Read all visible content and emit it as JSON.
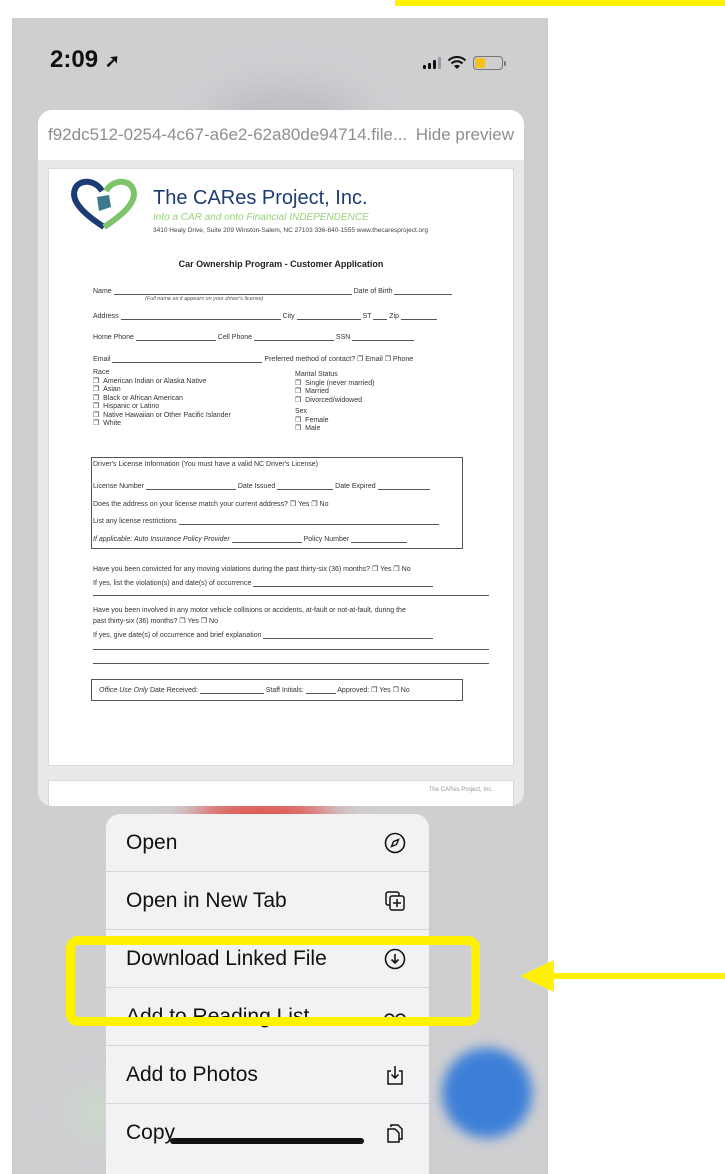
{
  "status_bar": {
    "time": "2:09"
  },
  "preview": {
    "url": "f92dc512-0254-4c67-a6e2-62a80de94714.file...",
    "hide_label": "Hide preview",
    "document": {
      "org_name": "The CARes Project, Inc.",
      "tagline": "Into a CAR and onto Financial INDEPENDENCE",
      "address": "3410 Healy Drive, Suite 209 Winston-Salem, NC 27103   336-840-1555   www.thecaresproject.org",
      "title": "Car Ownership Program - Customer Application",
      "name_label": "Name",
      "name_hint": "(Full name as it appears on your driver's license)",
      "dob_label": "Date of Birth",
      "address_label": "Address",
      "city_label": "City",
      "st_label": "ST",
      "zip_label": "Zip",
      "home_phone_label": "Home Phone",
      "cell_phone_label": "Cell Phone",
      "ssn_label": "SSN",
      "email_label": "Email",
      "contact_pref": "Preferred method of contact? ❒ Email  ❒ Phone",
      "race_label": "Race",
      "race_options": [
        "American Indian or Alaska Native",
        "Asian",
        "Black or African American",
        "Hispanic or Latino",
        "Native Hawaiian or Other Pacific Islander",
        "White"
      ],
      "marital_label": "Marital Status",
      "marital_options": [
        "Single (never married)",
        "Married",
        "Divorced/widowed"
      ],
      "sex_label": "Sex",
      "sex_options": [
        "Female",
        "Male"
      ],
      "license_header": "Driver's License Information (You must have a valid NC Driver's License)",
      "license_number": "License Number",
      "date_issued": "Date Issued",
      "date_expired": "Date Expired",
      "address_match": "Does the address on your license match your current address? ❒  Yes ❒   No",
      "restrictions": "List any license restrictions",
      "insurance": "If applicable: Auto Insurance Policy Provider",
      "policy_number": "Policy Number",
      "violations_q": "Have you been convicted for any moving violations during the past thirty-six (36) months? ❒ Yes ❒ No",
      "violations_list": "If yes, list the violation(s) and date(s) of occurrence",
      "collisions_q": "Have you been involved in any motor vehicle collisions or accidents, at-fault or not-at-fault, during the",
      "collisions_q2": "past thirty-six (36) months?  ❒ Yes  ❒ No",
      "collisions_explain": "If yes, give date(s) of occurrence and brief explanation",
      "office_use": "Office Use Only",
      "date_received": "Date Received:",
      "staff_initials": "Staff Initials:",
      "approved": "Approved: ❒ Yes ❒ No",
      "page2_footer": "The CARes Project, Inc."
    }
  },
  "menu": {
    "items": [
      {
        "label": "Open",
        "icon": "compass-icon"
      },
      {
        "label": "Open in New Tab",
        "icon": "plus-square-on-square-icon"
      },
      {
        "label": "Download Linked File",
        "icon": "arrow-down-circle-icon"
      },
      {
        "label": "Add to Reading List",
        "icon": "eyeglasses-icon"
      },
      {
        "label": "Add to Photos",
        "icon": "square-and-arrow-down-icon"
      },
      {
        "label": "Copy",
        "icon": "doc-on-doc-icon"
      }
    ]
  },
  "annotation": {
    "highlight_color": "#fff200"
  }
}
